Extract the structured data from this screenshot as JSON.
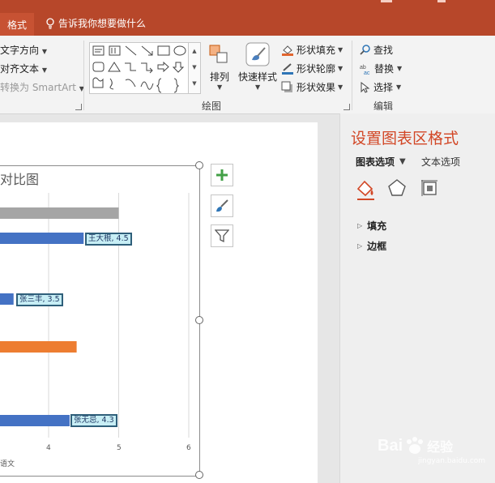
{
  "ribbon_tabs": {
    "format": "格式"
  },
  "tell_me": "告诉我你想要做什么",
  "text_group": {
    "direction": "文字方向",
    "align": "对齐文本",
    "smartart": "转换为 SmartArt"
  },
  "drawing_group": {
    "arrange": "排列",
    "quick_styles": "快速样式",
    "shape_fill": "形状填充",
    "shape_outline": "形状轮廓",
    "shape_effects": "形状效果",
    "label": "绘图"
  },
  "editing_group": {
    "find": "查找",
    "replace": "替换",
    "select": "选择",
    "label": "编辑"
  },
  "format_pane": {
    "title": "设置图表区格式",
    "tab_chart": "图表选项",
    "tab_text": "文本选项",
    "section_fill": "填充",
    "section_border": "边框"
  },
  "chart_data": {
    "type": "bar",
    "title": "对比图",
    "xlim": [
      0,
      6
    ],
    "x_ticks_visible": [
      "4",
      "5",
      "6"
    ],
    "x_axis_fragment": "语文",
    "grid": true,
    "bars": [
      {
        "value": 5,
        "color": "#a5a5a5",
        "label": ""
      },
      {
        "value": 4.5,
        "color": "#4472c4",
        "label": "王大根, 4.5"
      },
      {
        "value": 3.5,
        "color": "#4472c4",
        "label": "张三丰, 3.5"
      },
      {
        "value": 4.4,
        "color": "#ed7d31",
        "label": ""
      },
      {
        "value": 4.3,
        "color": "#4472c4",
        "label": "张无忌, 4.3"
      }
    ]
  },
  "watermark": {
    "brand": "Bai",
    "suffix": "经验",
    "url": "jingyan.baidu.com"
  },
  "colors": {
    "accent": "#b7472a",
    "pane_title": "#d24726",
    "add_icon": "#43a047"
  }
}
